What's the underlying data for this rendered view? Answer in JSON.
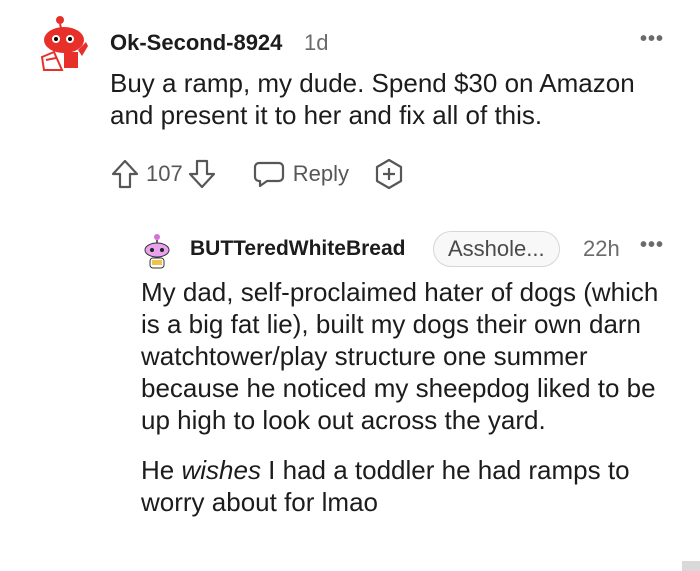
{
  "comment1": {
    "username": "Ok-Second-8924",
    "age": "1d",
    "body": "Buy a ramp, my dude. Spend $30 on Amazon and present it to her and fix all of this.",
    "upvotes": "107",
    "reply_label": "Reply",
    "more_icon": "more-icon",
    "avatar_icon": "reddit-snoo-avatar"
  },
  "comment2": {
    "username": "BUTTeredWhiteBread",
    "flair": "Asshole...",
    "age": "22h",
    "paragraph1": "My dad, self-proclaimed hater of dogs (which is a big fat lie), built my dogs their own darn watchtower/play structure one summer because he noticed my sheepdog liked to be up high to look out across the yard.",
    "p2_before": "He ",
    "p2_emph": "wishes",
    "p2_after": " I had a toddler he had ramps to worry about for lmao",
    "avatar_icon": "reddit-snoo-avatar"
  },
  "colors": {
    "text": "#1c1c1c",
    "muted": "#6b6b6b",
    "avatar_red": "#e8302a"
  }
}
